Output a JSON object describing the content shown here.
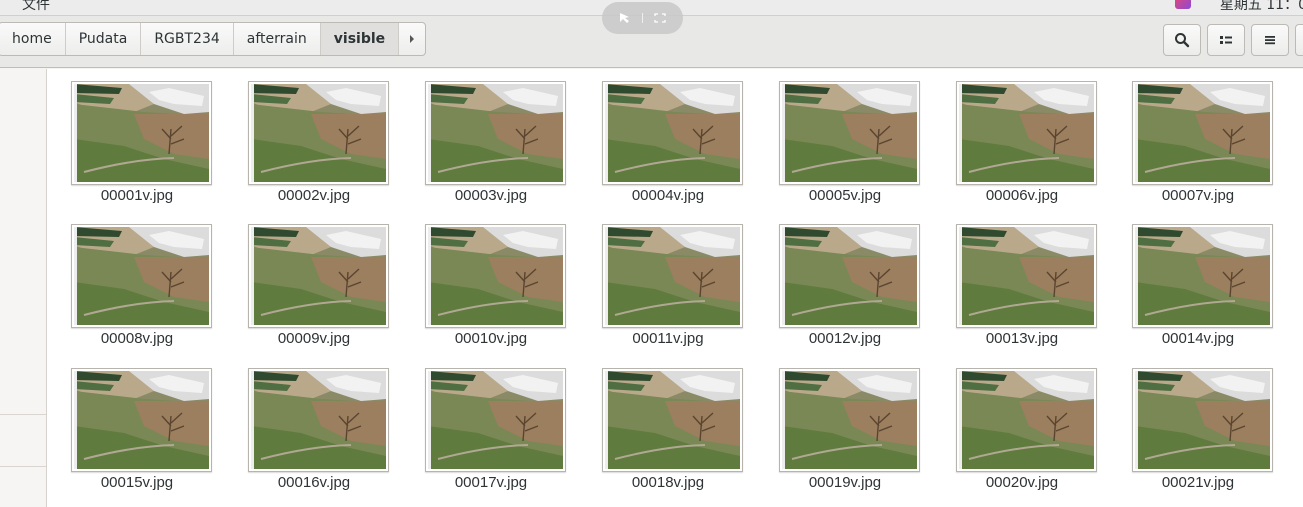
{
  "topbar": {
    "app_menu": "文件",
    "clock": "星期五 11：0"
  },
  "breadcrumbs": [
    {
      "label": "home",
      "active": false
    },
    {
      "label": "Pudata",
      "active": false
    },
    {
      "label": "RGBT234",
      "active": false
    },
    {
      "label": "afterrain",
      "active": false
    },
    {
      "label": "visible",
      "active": true
    }
  ],
  "toolbar": {
    "search_icon": "search-icon",
    "view_icon": "list-view-icon",
    "menu_icon": "hamburger-menu-icon"
  },
  "files": [
    "00001v.jpg",
    "00002v.jpg",
    "00003v.jpg",
    "00004v.jpg",
    "00005v.jpg",
    "00006v.jpg",
    "00007v.jpg",
    "00008v.jpg",
    "00009v.jpg",
    "00010v.jpg",
    "00011v.jpg",
    "00012v.jpg",
    "00013v.jpg",
    "00014v.jpg",
    "00015v.jpg",
    "00016v.jpg",
    "00017v.jpg",
    "00018v.jpg",
    "00019v.jpg",
    "00020v.jpg",
    "00021v.jpg"
  ]
}
